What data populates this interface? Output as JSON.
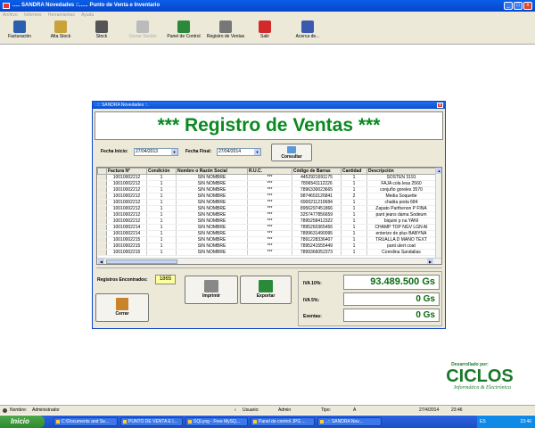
{
  "window": {
    "title": "..... SANDRA Novedades ::...... Punto de Venta e Inventario",
    "btn_min": "_",
    "btn_max": "□",
    "btn_close": "x"
  },
  "menu": [
    "Archivo",
    "Informes",
    "Herramientas",
    "Ayuda"
  ],
  "toolbar": [
    {
      "label": "Facturación",
      "icon": "calculator-icon",
      "color": "#2a5fb0",
      "enabled": true
    },
    {
      "label": "Alta Stock",
      "icon": "document-edit-icon",
      "color": "#c9a23a",
      "enabled": true
    },
    {
      "label": "Stock",
      "icon": "glasses-icon",
      "color": "#555555",
      "enabled": true
    },
    {
      "label": "Cerrar Sesión",
      "icon": "logout-icon",
      "color": "#bbbbbb",
      "enabled": false
    },
    {
      "label": "Panel de Control",
      "icon": "tools-icon",
      "color": "#2a8a3a",
      "enabled": true
    },
    {
      "label": "Registro de Ventas",
      "icon": "printer-icon",
      "color": "#777777",
      "enabled": true
    },
    {
      "label": "Salir",
      "icon": "exit-icon",
      "color": "#d22a2a",
      "enabled": true
    },
    {
      "label": "Acerca de...",
      "icon": "book-icon",
      "color": "#3a5ab0",
      "enabled": true
    }
  ],
  "form": {
    "title": ".::: SANDRA Novedades ::.",
    "close": "x",
    "banner": "*** Registro de Ventas ***",
    "fecha_inicio_label": "Fecha Inicio:",
    "fecha_inicio": "27/04/2013",
    "fecha_final_label": "Fecha Final:",
    "fecha_final": "27/04/2014",
    "consultar": "Consultar",
    "columns": [
      "",
      "Factura N°",
      "Condición",
      "Nombre o Razón Social",
      "R.U.C.",
      "Código de Barras",
      "Cantidad",
      "Descripción"
    ],
    "rows": [
      [
        "10010002212",
        "1",
        "SIN NOMBRE",
        "***",
        "4452921691175",
        "1",
        "SOSTEN 3191"
      ],
      [
        "10010002212",
        "1",
        "SIN NOMBRE",
        "***",
        "7896541112226",
        "1",
        "FAJA cola lesa 2560"
      ],
      [
        "10010002212",
        "1",
        "SIN NOMBRE",
        "***",
        "7896330023665",
        "1",
        "conjuño goreles 3570"
      ],
      [
        "10010002212",
        "1",
        "SIN NOMBRE",
        "***",
        "9874653126841",
        "2",
        "Media Soquette"
      ],
      [
        "10010002212",
        "1",
        "SIN NOMBRE",
        "***",
        "6900211210684",
        "1",
        "chatita poda 684"
      ],
      [
        "10010002212",
        "1",
        "SIN NOMBRE",
        "***",
        "8956297451866",
        "1",
        "Zapato Parthenon P FINA"
      ],
      [
        "10010002212",
        "1",
        "SIN NOMBRE",
        "***",
        "3257477856659",
        "1",
        "pant jeans dama Sodeum"
      ],
      [
        "10010002212",
        "1",
        "SIN NOMBRE",
        "***",
        "7895258412322",
        "1",
        "biquini p na YANI"
      ],
      [
        "10010002214",
        "1",
        "SIN NOMBRE",
        "***",
        "7895260365456",
        "1",
        "CHAMP TOP NGV LGN AI"
      ],
      [
        "10010002214",
        "1",
        "SIN NOMBRE",
        "***",
        "7899631490095",
        "1",
        "enterizo de plus BABYÑA"
      ],
      [
        "10010002215",
        "1",
        "SIN NOMBRE",
        "***",
        "7891228336407",
        "1",
        "TRUALLA D MANO TEXT"
      ],
      [
        "10010002215",
        "1",
        "SIN NOMBRE",
        "***",
        "7895241555449",
        "1",
        "pant ulert coat"
      ],
      [
        "10010002215",
        "1",
        "SIN NOMBRE",
        "***",
        "7899366052373",
        "1",
        "Conrdina Sandalias"
      ]
    ],
    "registros_label": "Registros Encontrados:",
    "registros": "1865",
    "imprimir": "Imprimir",
    "exportar": "Exportar",
    "cerrar": "Cerrar",
    "iva10_label": "IVA 10%:",
    "iva10": "93.489.500 Gs",
    "iva5_label": "IVA 5%:",
    "iva5": "0 Gs",
    "exentas_label": "Exentas:",
    "exentas": "0 Gs"
  },
  "brand": {
    "developed_by": "Desarrollado por:",
    "name": "CICLOS",
    "tagline": "Informática & Electrónica",
    "color": "#1a7a2a"
  },
  "status": {
    "nombre_label": "Nombre:",
    "nombre": "Administrador",
    "usuario_label": "Usuario:",
    "usuario": "Admin",
    "tipo_label": "Tipo:",
    "tipo": "A",
    "fecha": "27/4/2014",
    "hora": "23:46"
  },
  "taskbar": {
    "start": "Inicio",
    "tasks": [
      "C:\\Documents and Se...",
      "PUNTO DE VENTA E I...",
      "SQLyog - Free MySQ...",
      "Panel de control JPG ...",
      "..:: SANDRA Nov..."
    ],
    "lang": "ES",
    "clock": "23:46"
  }
}
